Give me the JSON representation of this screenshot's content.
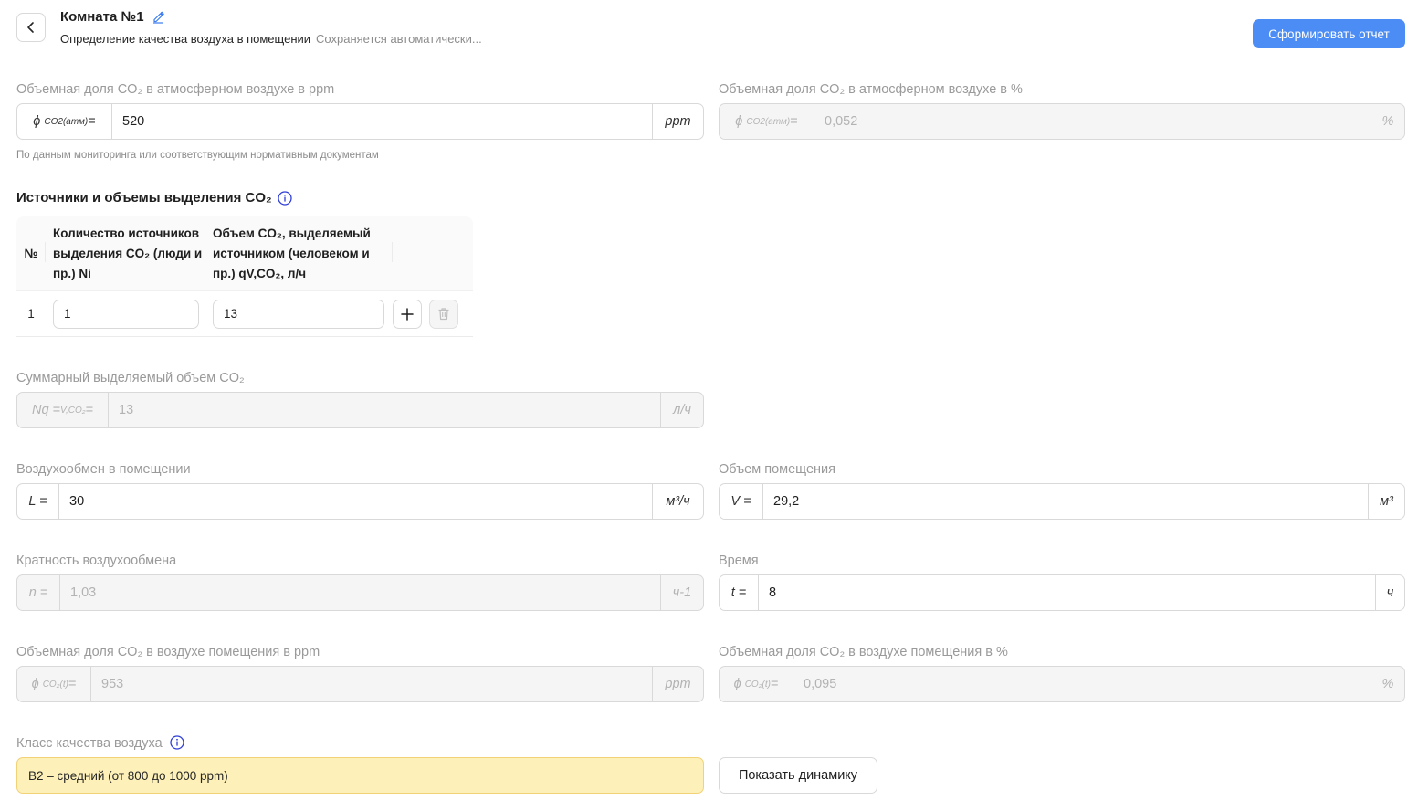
{
  "header": {
    "title": "Комната №1",
    "subtitle": "Определение качества воздуха в помещении",
    "autosave_status": "Сохраняется автоматически...",
    "report_button": "Сформировать отчет"
  },
  "atm_ppm": {
    "label": "Объемная доля CO₂ в атмосферном воздухе в ppm",
    "prefix_main": "ϕ",
    "prefix_sub": "CO2(атм)",
    "prefix_eq": "=",
    "value": "520",
    "unit": "ppm",
    "hint": "По данным мониторинга или соответствующим нормативным документам"
  },
  "atm_pct": {
    "label": "Объемная доля CO₂ в атмосферном воздухе в %",
    "prefix_main": "ϕ",
    "prefix_sub": "CO2(атм)",
    "prefix_eq": "=",
    "value": "0,052",
    "unit": "%"
  },
  "sources": {
    "title": "Источники и объемы выделения CO₂",
    "headers": {
      "num": "№",
      "count": "Количество источников выделения CO₂ (люди и пр.) Ni",
      "volume": "Объем CO₂, выделяемый источником (человеком и пр.) qV,CO₂, л/ч"
    },
    "rows": [
      {
        "num": "1",
        "count": "1",
        "volume": "13"
      }
    ]
  },
  "total_volume": {
    "label": "Суммарный выделяемый объем CO₂",
    "prefix_main": "Nq =",
    "prefix_sub": "V,CO₂",
    "prefix_eq": "=",
    "value": "13",
    "unit": "л/ч"
  },
  "air_exchange": {
    "label": "Воздухообмен в помещении",
    "prefix": "L =",
    "value": "30",
    "unit": "м³/ч"
  },
  "room_volume": {
    "label": "Объем помещения",
    "prefix": "V =",
    "value": "29,2",
    "unit": "м³"
  },
  "exchange_rate": {
    "label": "Кратность воздухообмена",
    "prefix": "n =",
    "value": "1,03",
    "unit": "ч-1"
  },
  "time": {
    "label": "Время",
    "prefix": "t =",
    "value": "8",
    "unit": "ч"
  },
  "room_ppm": {
    "label": "Объемная доля CO₂ в воздухе помещения в ppm",
    "prefix_main": "ϕ",
    "prefix_sub": "CO₂(t)",
    "prefix_eq": "=",
    "value": "953",
    "unit": "ppm"
  },
  "room_pct": {
    "label": "Объемная доля CO₂ в воздухе помещения в %",
    "prefix_main": "ϕ",
    "prefix_sub": "CO₂(t)",
    "prefix_eq": "=",
    "value": "0,095",
    "unit": "%"
  },
  "air_class": {
    "label": "Класс качества воздуха",
    "value": "В2 – средний (от 800 до 1000 ppm)",
    "dynamics_button": "Показать динамику"
  },
  "colors": {
    "primary": "#4c8cf5",
    "warning_bg": "#fdf0b8",
    "info_icon": "#2f3fd6"
  }
}
